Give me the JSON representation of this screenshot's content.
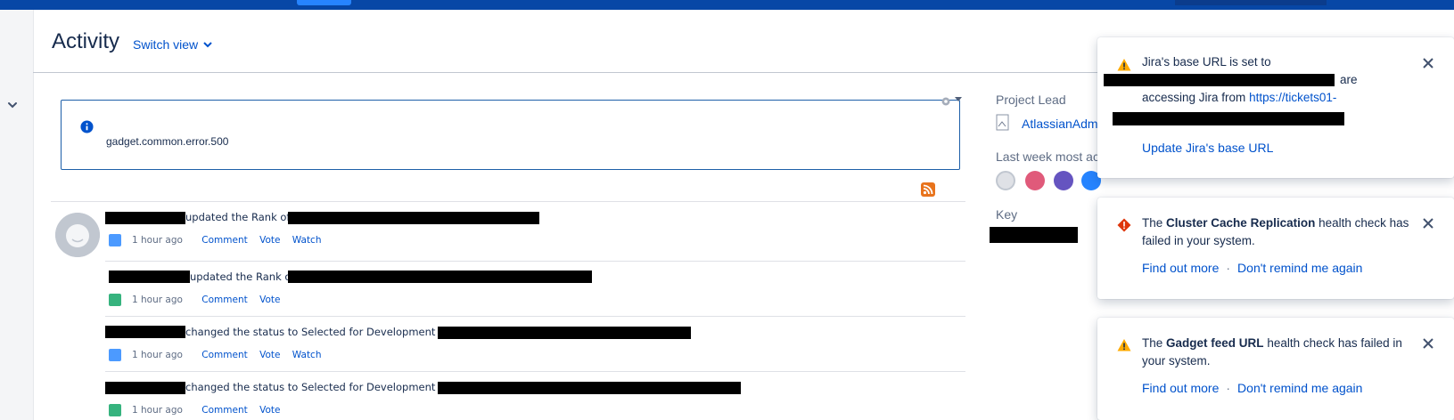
{
  "page": {
    "title": "Activity",
    "switch_view": "Switch view"
  },
  "gadget": {
    "error_text": "gadget.common.error.500"
  },
  "activity": {
    "items": [
      {
        "action": "updated the Rank of",
        "issue_type": "subtask",
        "time": "1 hour ago",
        "links": [
          "Comment",
          "Vote",
          "Watch"
        ]
      },
      {
        "action": "updated the Rank of",
        "issue_type": "story",
        "time": "1 hour ago",
        "links": [
          "Comment",
          "Vote"
        ]
      },
      {
        "action": "changed the status to Selected for Development on",
        "issue_type": "subtask",
        "time": "1 hour ago",
        "links": [
          "Comment",
          "Vote",
          "Watch"
        ]
      },
      {
        "action": "changed the status to Selected for Development on",
        "issue_type": "story",
        "time": "1 hour ago",
        "links": [
          "Comment",
          "Vote"
        ]
      }
    ]
  },
  "sidebar": {
    "project_lead_label": "Project Lead",
    "project_lead_name": "AtlassianAdm",
    "most_active_label": "Last week most ac",
    "key_label": "Key"
  },
  "flags": [
    {
      "type": "warning",
      "line1": "Jira's base URL is set to",
      "line2_suffix": "are",
      "line3_prefix": "accessing Jira from",
      "line3_link": "https://tickets01-",
      "action": "Update Jira's base URL"
    },
    {
      "type": "error",
      "prefix": "The",
      "bold": "Cluster Cache Replication",
      "suffix": "health check has failed in your system.",
      "actions": [
        "Find out more",
        "Don't remind me again"
      ]
    },
    {
      "type": "warning",
      "prefix": "The",
      "bold": "Gadget feed URL",
      "suffix": "health check has failed in your system.",
      "actions": [
        "Find out more",
        "Don't remind me again"
      ]
    }
  ],
  "colors": {
    "topbar": "#0747a6",
    "link": "#0052cc",
    "warning": "#ffab00",
    "error": "#de350b",
    "story": "#36b37e",
    "subtask": "#4c9aff"
  }
}
